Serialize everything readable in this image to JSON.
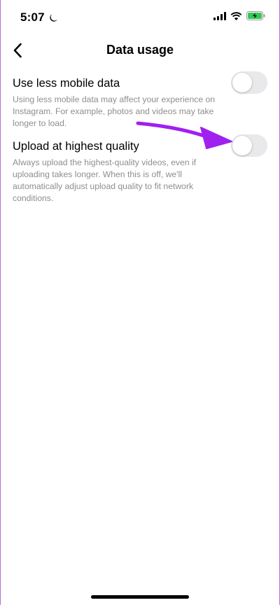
{
  "status_bar": {
    "time": "5:07",
    "icons": [
      "moon-icon",
      "signal-icon",
      "wifi-icon",
      "battery-charging-icon"
    ]
  },
  "header": {
    "title": "Data usage",
    "back_icon": "chevron-left-icon"
  },
  "settings": [
    {
      "title": "Use less mobile data",
      "description": "Using less mobile data may affect your experience on Instagram. For example, photos and videos may take longer to load.",
      "enabled": false
    },
    {
      "title": "Upload at highest quality",
      "description": "Always upload the highest-quality videos, even if uploading takes longer. When this is off, we'll automatically adjust upload quality to fit network conditions.",
      "enabled": false
    }
  ],
  "colors": {
    "toggle_off": "#e9e9eb",
    "description_text": "#8e8e8e",
    "annotation_arrow": "#a020f0",
    "battery_charging": "#34c759"
  }
}
